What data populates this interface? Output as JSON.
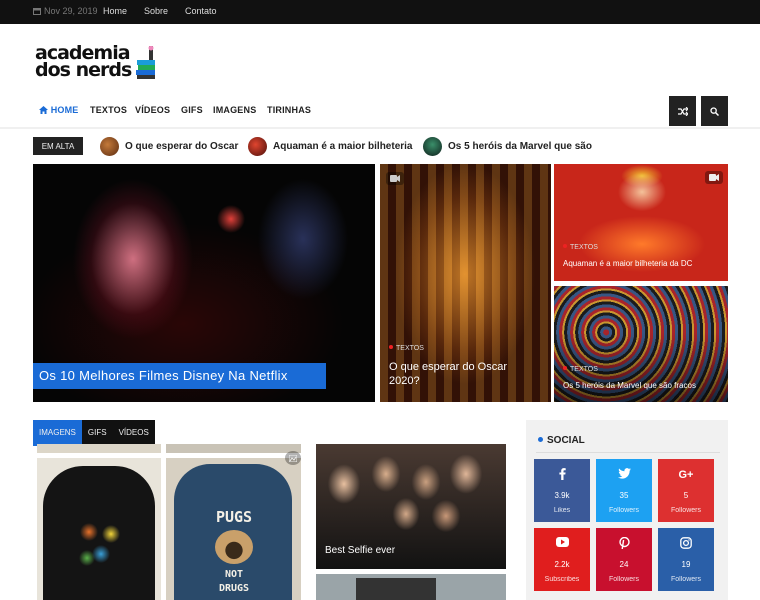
{
  "topbar": {
    "date": "Nov 29, 2019",
    "links": [
      "Home",
      "Sobre",
      "Contato"
    ]
  },
  "logo": {
    "line1": "academia",
    "line2": "dos nerds"
  },
  "nav": {
    "items": [
      "HOME",
      "TEXTOS",
      "VÍDEOS",
      "GIFS",
      "IMAGENS",
      "TIRINHAS"
    ]
  },
  "trending": {
    "badge": "EM ALTA",
    "items": [
      "O que esperar do Oscar",
      "Aquaman é a maior bilheteria",
      "Os 5 heróis da Marvel que são"
    ]
  },
  "featured": {
    "main": {
      "title": "Os 10 Melhores Filmes Disney Na Netflix"
    },
    "oscar": {
      "category": "TEXTOS",
      "title_line1": "O que esperar do Oscar",
      "title_line2": "2020?"
    },
    "aquaman": {
      "category": "TEXTOS",
      "title": "Aquaman é a maior bilheteria da DC"
    },
    "marvel": {
      "category": "TEXTOS",
      "title": "Os 5 heróis da Marvel que são fracos"
    }
  },
  "tabs": [
    "IMAGENS",
    "GIFS",
    "VÍDEOS"
  ],
  "posts": {
    "selfie": "Best Selfie ever",
    "shirt_text_top": "PUGS",
    "shirt_text_bottom": "NOT DRUGS"
  },
  "social": {
    "title": "SOCIAL",
    "buttons": [
      {
        "name": "facebook",
        "count": "3.9k",
        "label": "Likes",
        "color": "#3b5998"
      },
      {
        "name": "twitter",
        "count": "35",
        "label": "Followers",
        "color": "#1da1f2"
      },
      {
        "name": "google-plus",
        "count": "5",
        "label": "Followers",
        "color": "#dd3030"
      },
      {
        "name": "youtube",
        "count": "2.2k",
        "label": "Subscribes",
        "color": "#e01e1e"
      },
      {
        "name": "pinterest",
        "count": "24",
        "label": "Followers",
        "color": "#c8102e"
      },
      {
        "name": "instagram",
        "count": "19",
        "label": "Followers",
        "color": "#2a5fa8"
      }
    ]
  },
  "colors": {
    "accent": "#1a6bd6",
    "dark": "#111111",
    "marker": "#e22222"
  }
}
